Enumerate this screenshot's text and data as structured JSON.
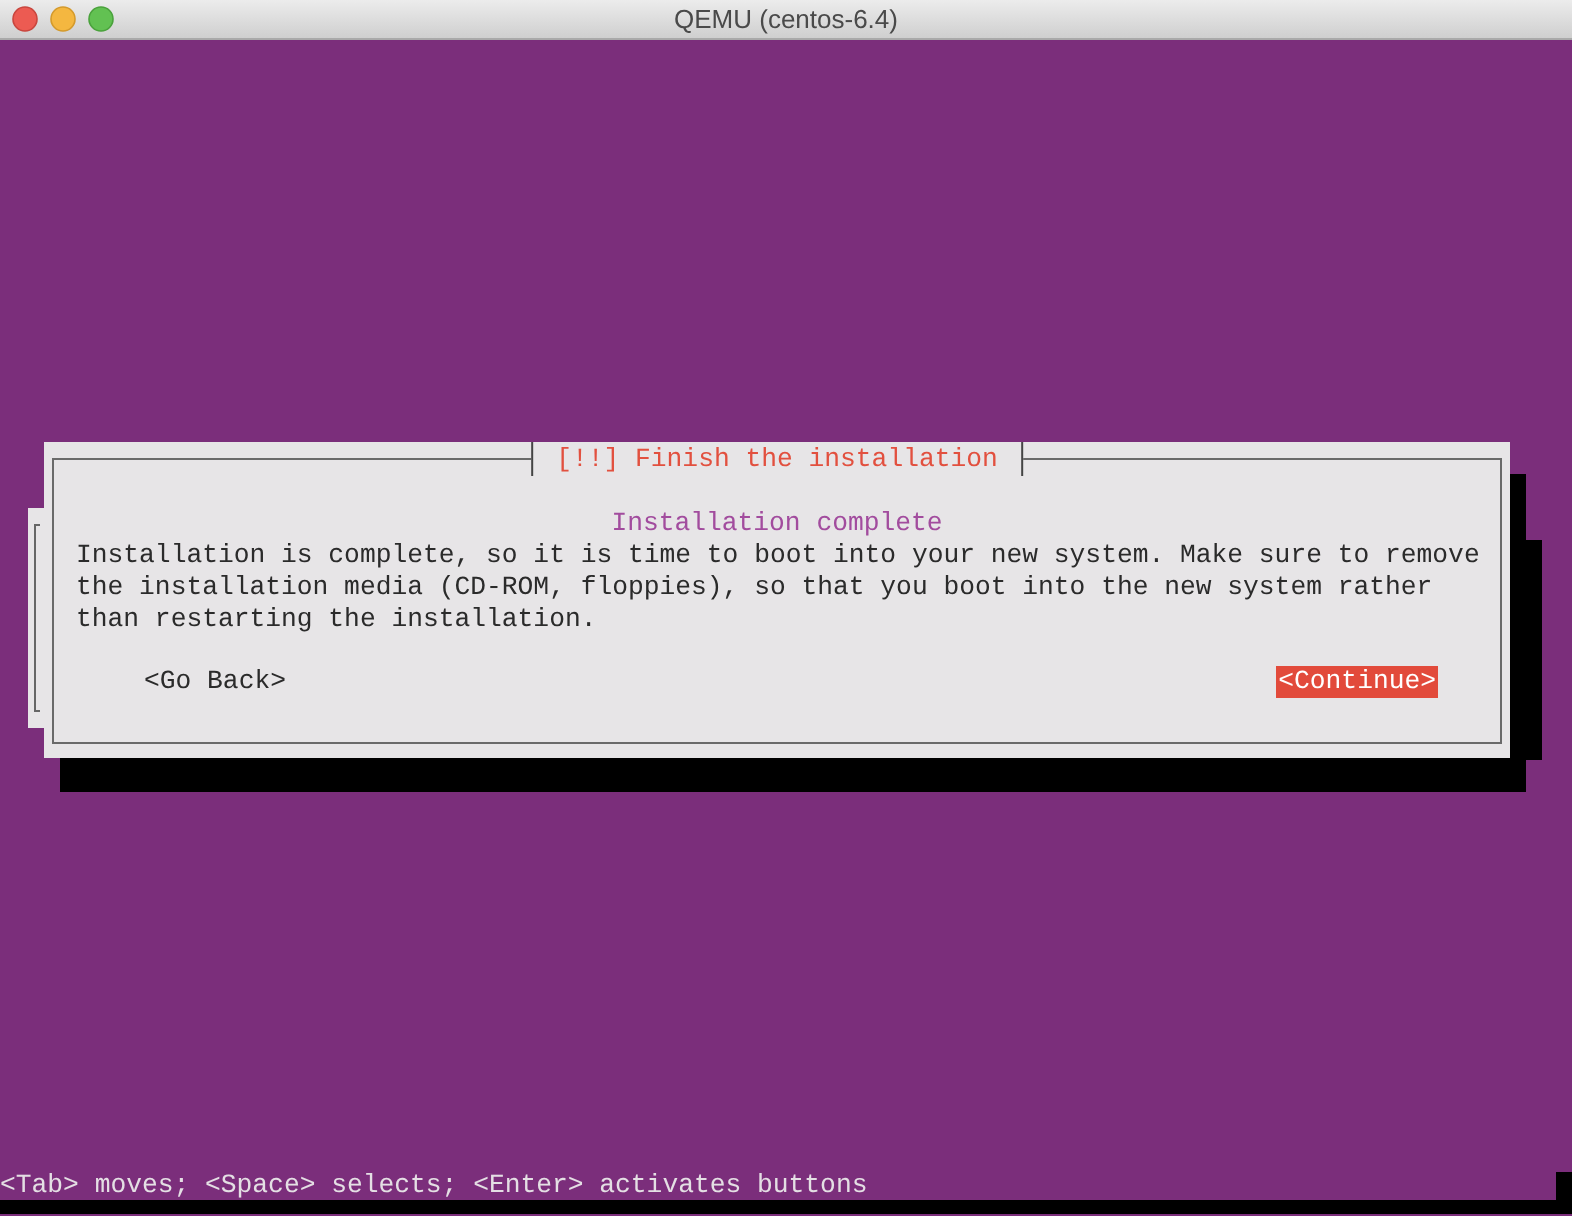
{
  "window": {
    "title": "QEMU (centos-6.4)"
  },
  "dialog": {
    "title": "[!!] Finish the installation",
    "heading": "Installation complete",
    "message": "Installation is complete, so it is time to boot into your new system. Make sure to remove the installation media (CD-ROM, floppies), so that you boot into the new system rather than restarting the installation.",
    "buttons": [
      {
        "label": "<Go Back>",
        "selected": false
      },
      {
        "label": "<Continue>",
        "selected": true
      }
    ]
  },
  "help_line": "<Tab> moves; <Space> selects; <Enter> activates buttons"
}
